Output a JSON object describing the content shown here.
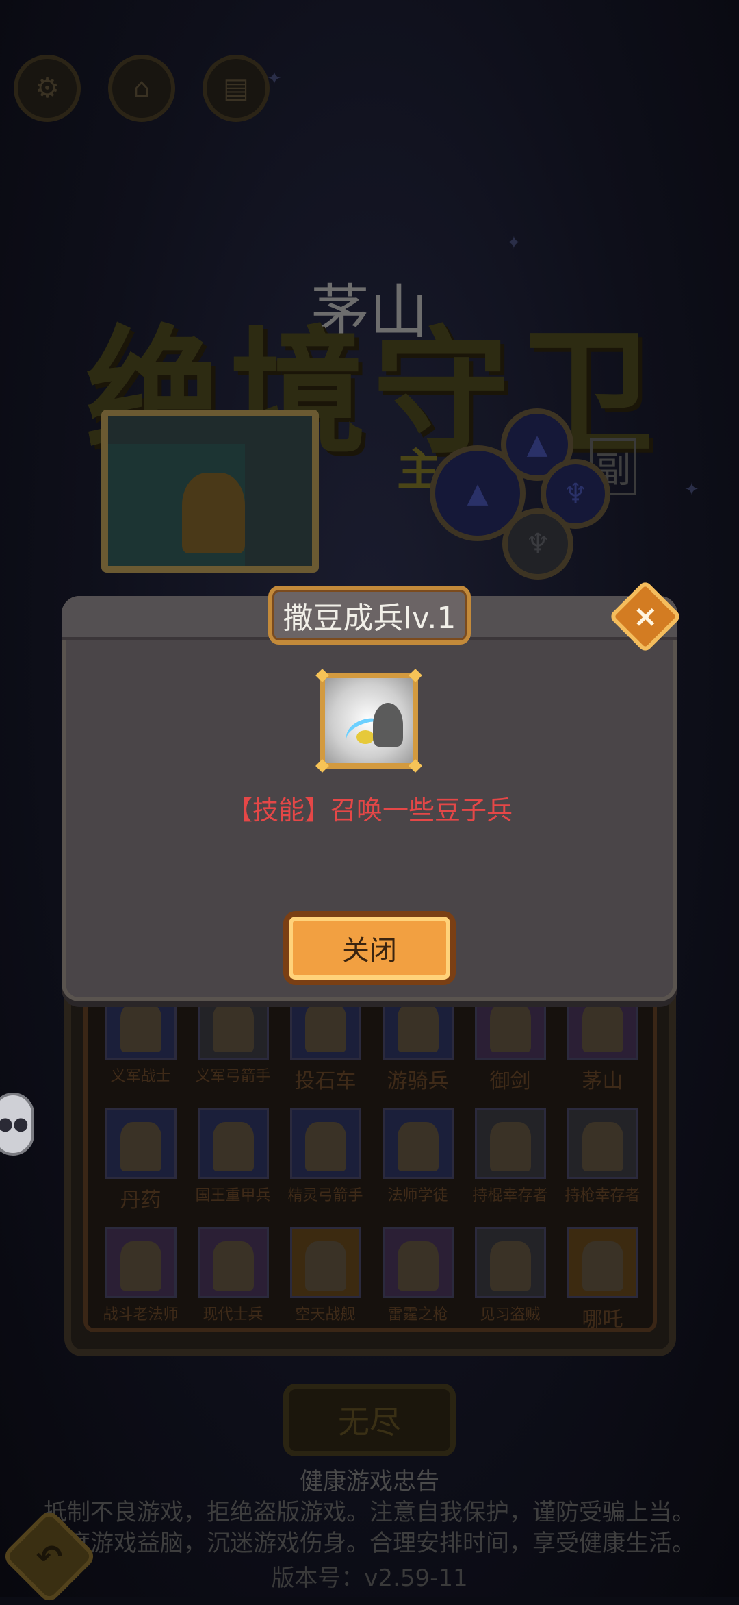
{
  "background": {
    "hero_name": "茅山",
    "logo_text": "绝境守卫",
    "main_label": "主",
    "sub_label": "副"
  },
  "units": [
    {
      "name": "义军战士",
      "tile": "blue"
    },
    {
      "name": "义军弓箭手",
      "tile": "gray"
    },
    {
      "name": "投石车",
      "tile": "blue"
    },
    {
      "name": "游骑兵",
      "tile": "blue"
    },
    {
      "name": "御剑",
      "tile": "purple"
    },
    {
      "name": "茅山",
      "tile": "purple"
    },
    {
      "name": "丹药",
      "tile": "blue"
    },
    {
      "name": "国王重甲兵",
      "tile": "blue"
    },
    {
      "name": "精灵弓箭手",
      "tile": "blue"
    },
    {
      "name": "法师学徒",
      "tile": "blue"
    },
    {
      "name": "持棍幸存者",
      "tile": "gray"
    },
    {
      "name": "持枪幸存者",
      "tile": "gray"
    },
    {
      "name": "战斗老法师",
      "tile": "purple"
    },
    {
      "name": "现代士兵",
      "tile": "purple"
    },
    {
      "name": "空天战舰",
      "tile": "orange"
    },
    {
      "name": "雷霆之枪",
      "tile": "purple"
    },
    {
      "name": "见习盗贼",
      "tile": "gray"
    },
    {
      "name": "哪吒",
      "tile": "orange"
    }
  ],
  "bottom": {
    "endless_label": "无尽",
    "notice_title": "健康游戏忠告",
    "notice_line1": "抵制不良游戏，拒绝盗版游戏。注意自我保护，谨防受骗上当。",
    "notice_line2": "适度游戏益脑，沉迷游戏伤身。合理安排时间，享受健康生活。",
    "version": "版本号：v2.59-11"
  },
  "modal": {
    "title": "撒豆成兵lv.1",
    "description": "【技能】召唤一些豆子兵",
    "close_label": "关闭",
    "close_icon": "×"
  },
  "colors": {
    "modal_bg": "#4a4548",
    "description": "#e54747",
    "button": "#f2a041",
    "frame_gold": "#d39a3f"
  }
}
